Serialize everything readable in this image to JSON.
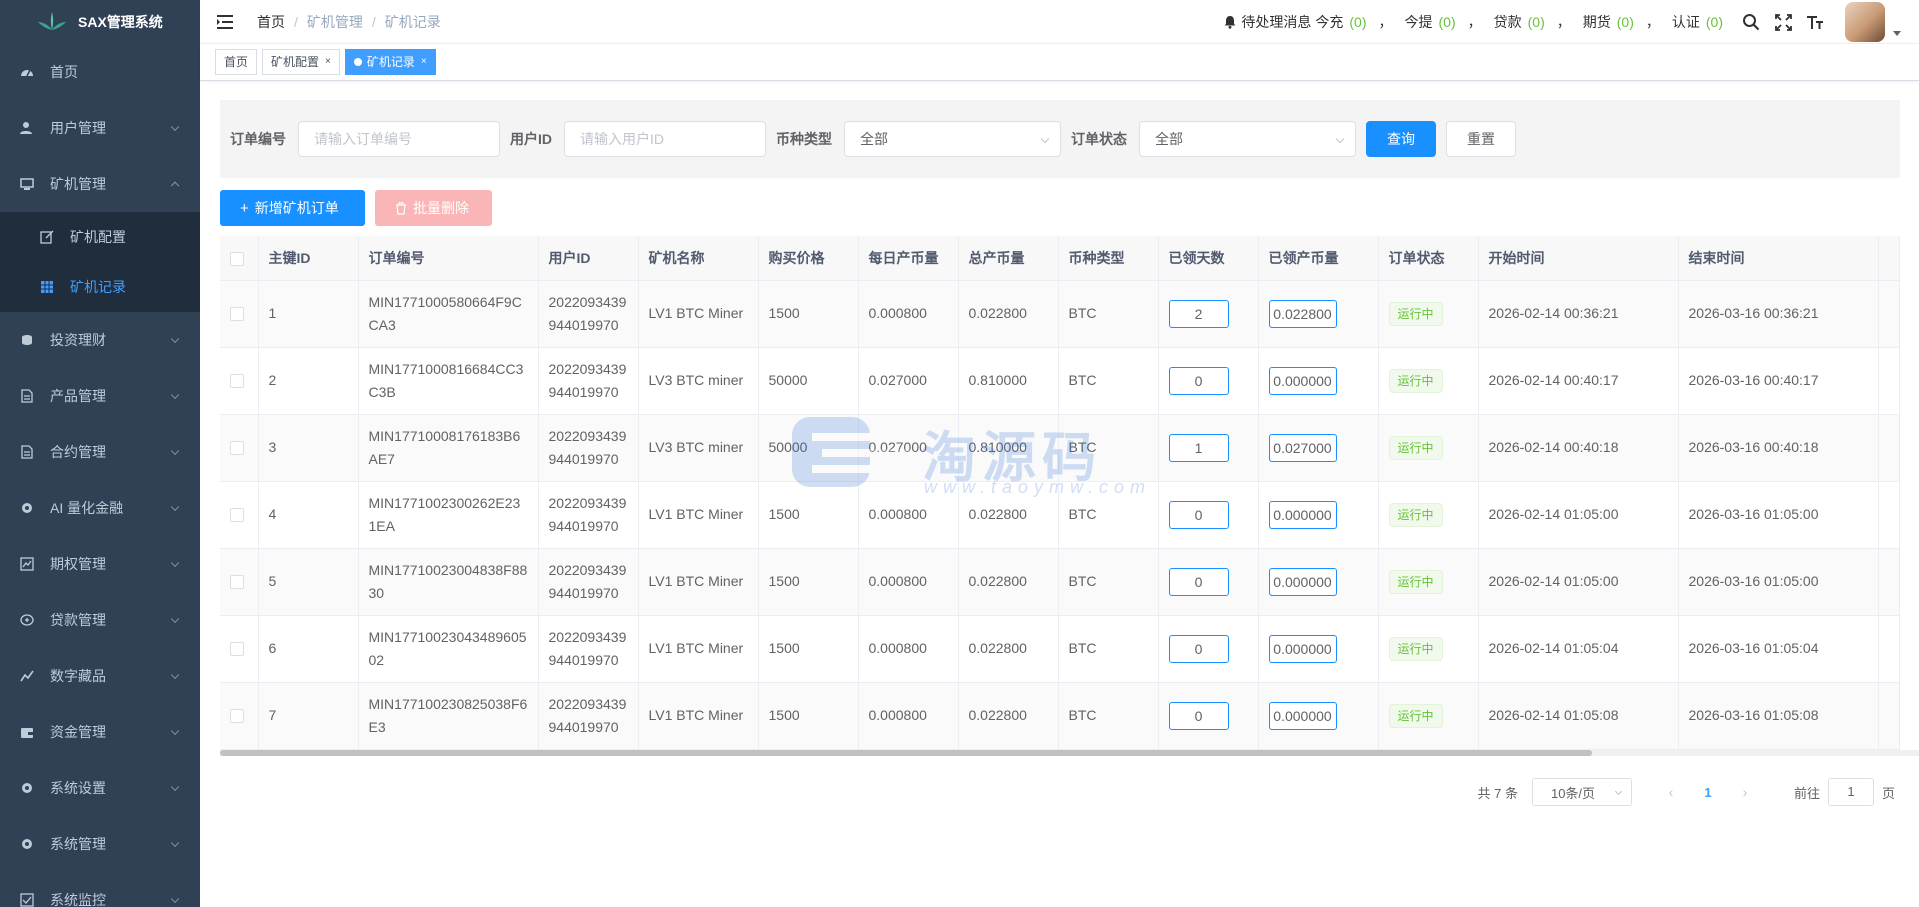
{
  "app": {
    "title": "SAX管理系统"
  },
  "sidebar": {
    "items": [
      {
        "label": "首页",
        "icon": "dashboard-icon"
      },
      {
        "label": "用户管理",
        "icon": "user-icon"
      },
      {
        "label": "矿机管理",
        "icon": "monitor-icon",
        "expanded": true,
        "children": [
          {
            "label": "矿机配置",
            "icon": "edit-icon"
          },
          {
            "label": "矿机记录",
            "icon": "table-icon",
            "active": true
          }
        ]
      },
      {
        "label": "投资理财",
        "icon": "coins-icon"
      },
      {
        "label": "产品管理",
        "icon": "document-icon"
      },
      {
        "label": "合约管理",
        "icon": "document-icon"
      },
      {
        "label": "AI 量化金融",
        "icon": "gear-icon"
      },
      {
        "label": "期权管理",
        "icon": "chart-icon"
      },
      {
        "label": "贷款管理",
        "icon": "money-icon"
      },
      {
        "label": "数字藏品",
        "icon": "trend-icon"
      },
      {
        "label": "资金管理",
        "icon": "wallet-icon"
      },
      {
        "label": "系统设置",
        "icon": "gear-icon"
      },
      {
        "label": "系统管理",
        "icon": "gear-icon"
      },
      {
        "label": "系统监控",
        "icon": "check-icon"
      }
    ]
  },
  "breadcrumb": [
    "首页",
    "矿机管理",
    "矿机记录"
  ],
  "notice": {
    "label": "待处理消息",
    "items": [
      {
        "label": "今充",
        "count": "(0)"
      },
      {
        "label": "今提",
        "count": "(0)"
      },
      {
        "label": "贷款",
        "count": "(0)"
      },
      {
        "label": "期货",
        "count": "(0)"
      },
      {
        "label": "认证",
        "count": "(0)"
      }
    ],
    "separator": "，"
  },
  "tags": [
    {
      "label": "首页",
      "closable": false,
      "active": false
    },
    {
      "label": "矿机配置",
      "closable": true,
      "active": false
    },
    {
      "label": "矿机记录",
      "closable": true,
      "active": true
    }
  ],
  "tag_close": "×",
  "search": {
    "order_no_label": "订单编号",
    "order_no_placeholder": "请输入订单编号",
    "user_id_label": "用户ID",
    "user_id_placeholder": "请输入用户ID",
    "coin_label": "币种类型",
    "coin_value": "全部",
    "status_label": "订单状态",
    "status_value": "全部",
    "query_label": "查询",
    "reset_label": "重置"
  },
  "toolbar": {
    "add_label": "新增矿机订单",
    "delete_label": "批量删除"
  },
  "table": {
    "columns": [
      "主键ID",
      "订单编号",
      "用户ID",
      "矿机名称",
      "购买价格",
      "每日产币量",
      "总产币量",
      "币种类型",
      "已领天数",
      "已领产币量",
      "订单状态",
      "开始时间",
      "结束时间"
    ],
    "rows": [
      {
        "id": "1",
        "order_a": "MIN1771000580664F9C",
        "order_b": "CA3",
        "uid_a": "2022093439",
        "uid_b": "944019970",
        "name": "LV1 BTC Miner",
        "price": "1500",
        "daily": "0.000800",
        "total": "0.022800",
        "coin": "BTC",
        "days": "2",
        "claimed": "0.022800",
        "status": "运行中",
        "start": "2026-02-14 00:36:21",
        "end": "2026-03-16 00:36:21"
      },
      {
        "id": "2",
        "order_a": "MIN1771000816684CC3",
        "order_b": "C3B",
        "uid_a": "2022093439",
        "uid_b": "944019970",
        "name": "LV3 BTC miner",
        "price": "50000",
        "daily": "0.027000",
        "total": "0.810000",
        "coin": "BTC",
        "days": "0",
        "claimed": "0.000000",
        "status": "运行中",
        "start": "2026-02-14 00:40:17",
        "end": "2026-03-16 00:40:17"
      },
      {
        "id": "3",
        "order_a": "MIN17710008176183B6",
        "order_b": "AE7",
        "uid_a": "2022093439",
        "uid_b": "944019970",
        "name": "LV3 BTC miner",
        "price": "50000",
        "daily": "0.027000",
        "total": "0.810000",
        "coin": "BTC",
        "days": "1",
        "claimed": "0.027000",
        "status": "运行中",
        "start": "2026-02-14 00:40:18",
        "end": "2026-03-16 00:40:18"
      },
      {
        "id": "4",
        "order_a": "MIN1771002300262E23",
        "order_b": "1EA",
        "uid_a": "2022093439",
        "uid_b": "944019970",
        "name": "LV1 BTC Miner",
        "price": "1500",
        "daily": "0.000800",
        "total": "0.022800",
        "coin": "BTC",
        "days": "0",
        "claimed": "0.000000",
        "status": "运行中",
        "start": "2026-02-14 01:05:00",
        "end": "2026-03-16 01:05:00"
      },
      {
        "id": "5",
        "order_a": "MIN17710023004838F88",
        "order_b": "30",
        "uid_a": "2022093439",
        "uid_b": "944019970",
        "name": "LV1 BTC Miner",
        "price": "1500",
        "daily": "0.000800",
        "total": "0.022800",
        "coin": "BTC",
        "days": "0",
        "claimed": "0.000000",
        "status": "运行中",
        "start": "2026-02-14 01:05:00",
        "end": "2026-03-16 01:05:00"
      },
      {
        "id": "6",
        "order_a": "MIN17710023043489605",
        "order_b": "02",
        "uid_a": "2022093439",
        "uid_b": "944019970",
        "name": "LV1 BTC Miner",
        "price": "1500",
        "daily": "0.000800",
        "total": "0.022800",
        "coin": "BTC",
        "days": "0",
        "claimed": "0.000000",
        "status": "运行中",
        "start": "2026-02-14 01:05:04",
        "end": "2026-03-16 01:05:04"
      },
      {
        "id": "7",
        "order_a": "MIN177100230825038F6",
        "order_b": "E3",
        "uid_a": "2022093439",
        "uid_b": "944019970",
        "name": "LV1 BTC Miner",
        "price": "1500",
        "daily": "0.000800",
        "total": "0.022800",
        "coin": "BTC",
        "days": "0",
        "claimed": "0.000000",
        "status": "运行中",
        "start": "2026-02-14 01:05:08",
        "end": "2026-03-16 01:05:08"
      }
    ]
  },
  "pagination": {
    "total_text": "共 7 条",
    "page_size": "10条/页",
    "current": "1",
    "goto_label": "前往",
    "goto_value": "1",
    "page_suffix": "页",
    "prev": "‹",
    "next": "›"
  },
  "watermark": {
    "text": "淘源码",
    "url": "www.taoymw.com"
  },
  "colors": {
    "sidebar_bg": "#304156",
    "primary": "#1890ff",
    "active_menu": "#409eff",
    "success": "#67c23a",
    "danger_light": "#fab6b6"
  }
}
